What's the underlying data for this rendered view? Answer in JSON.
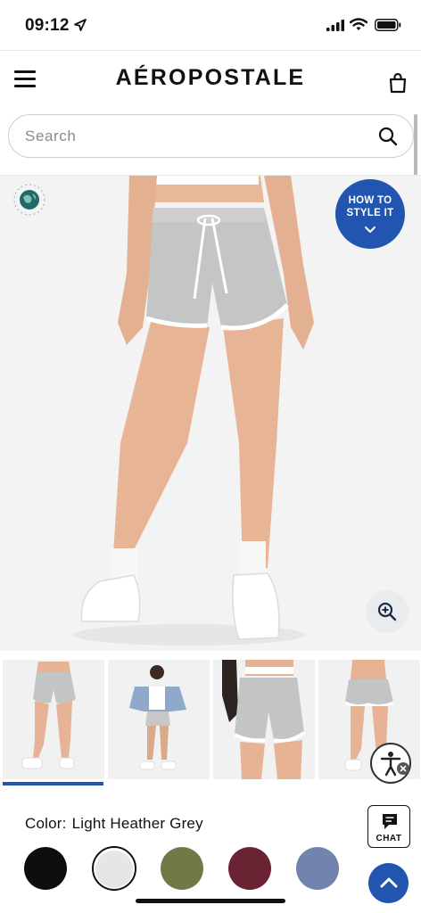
{
  "status_bar": {
    "time": "09:12",
    "icons": [
      "location-arrow-icon",
      "signal-icon",
      "wifi-icon",
      "battery-icon"
    ]
  },
  "header": {
    "brand": "AÉROPOSTALE",
    "menu_icon": "hamburger-menu-icon",
    "bag_icon": "shopping-bag-icon"
  },
  "search": {
    "placeholder": "Search",
    "value": "",
    "icon": "search-icon"
  },
  "hero": {
    "badge_icon": "impact-aero-globe-icon",
    "style_button": {
      "line1": "HOW TO",
      "line2": "STYLE IT",
      "icon": "chevron-down-icon"
    },
    "zoom_icon": "zoom-in-icon"
  },
  "thumbnails": {
    "count": 4,
    "active_index": 0
  },
  "color": {
    "prefix": "Color:",
    "selected_name": "Light Heather Grey",
    "swatches": [
      {
        "color": "#0e0e0e"
      },
      {
        "color": "#e6e6e4",
        "selected": true
      },
      {
        "color": "#707a47"
      },
      {
        "color": "#6a2333"
      },
      {
        "color": "#7283ad"
      }
    ]
  },
  "chat": {
    "label": "CHAT",
    "icon": "chat-bubble-icon"
  },
  "accessibility_icon": "accessibility-person-icon",
  "scroll_top_icon": "chevron-up-icon",
  "colors": {
    "accent": "#2155b0",
    "text": "#111111"
  }
}
